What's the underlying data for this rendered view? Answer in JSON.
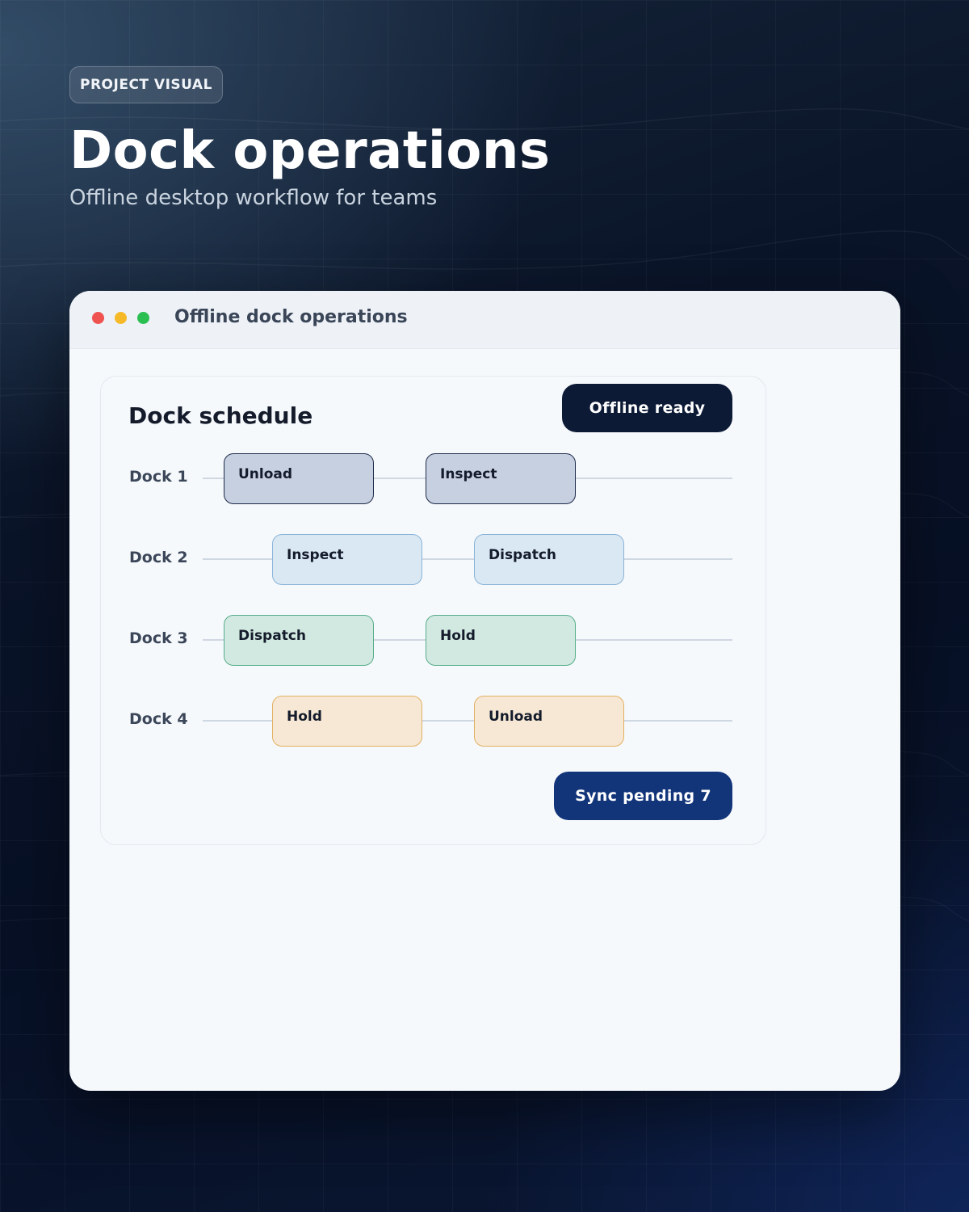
{
  "hero": {
    "badge": "PROJECT VISUAL",
    "title": "Dock operations",
    "subtitle": "Offline desktop workflow for teams"
  },
  "window": {
    "title": "Offline dock operations",
    "traffic_lights": [
      "close",
      "minimize",
      "maximize"
    ]
  },
  "schedule": {
    "title": "Dock schedule",
    "status_badge": "Offline ready",
    "sync_button": "Sync pending 7",
    "lanes": [
      {
        "label": "Dock 1",
        "tasks": [
          "Unload",
          "Inspect"
        ]
      },
      {
        "label": "Dock 2",
        "tasks": [
          "Inspect",
          "Dispatch"
        ]
      },
      {
        "label": "Dock 3",
        "tasks": [
          "Dispatch",
          "Hold"
        ]
      },
      {
        "label": "Dock 4",
        "tasks": [
          "Hold",
          "Unload"
        ]
      }
    ]
  },
  "colors": {
    "accent_dark": "#0c1a36",
    "accent_blue": "#12357a",
    "lane_1": "#c7d0e0",
    "lane_2": "#d9e8f3",
    "lane_3": "#d2e9e1",
    "lane_4": "#f6e8d4"
  }
}
